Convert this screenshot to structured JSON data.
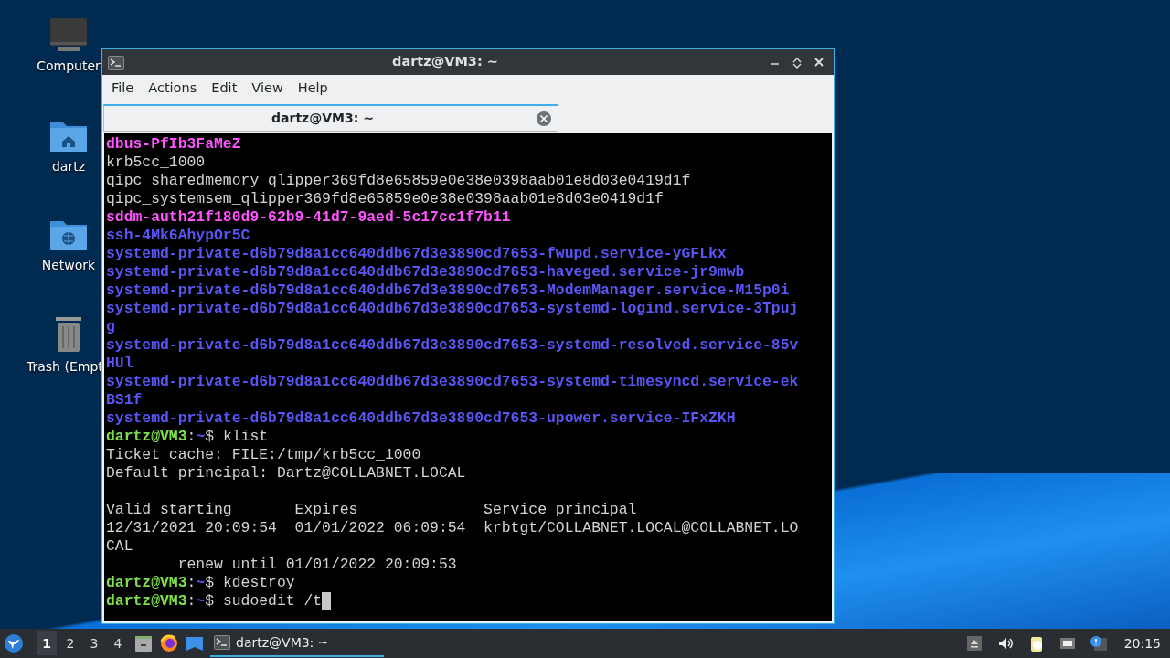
{
  "desktop_icons": [
    {
      "label": "Computer",
      "kind": "computer"
    },
    {
      "label": "dartz",
      "kind": "home"
    },
    {
      "label": "Network",
      "kind": "network"
    },
    {
      "label": "Trash (Empt",
      "kind": "trash"
    }
  ],
  "window": {
    "title": "dartz@VM3: ~",
    "menu": [
      "File",
      "Actions",
      "Edit",
      "View",
      "Help"
    ],
    "tabs": [
      {
        "label": "dartz@VM3: ~",
        "selected": true
      }
    ],
    "terminal_lines": [
      [
        {
          "kind": "socket",
          "text": "dbus-PfIb3FaMeZ"
        }
      ],
      [
        {
          "kind": "plain",
          "text": "krb5cc_1000"
        }
      ],
      [
        {
          "kind": "plain",
          "text": "qipc_sharedmemory_qlipper369fd8e65859e0e38e0398aab01e8d03e0419d1f"
        }
      ],
      [
        {
          "kind": "plain",
          "text": "qipc_systemsem_qlipper369fd8e65859e0e38e0398aab01e8d03e0419d1f"
        }
      ],
      [
        {
          "kind": "socket",
          "text": "sddm-auth21f180d9-62b9-41d7-9aed-5c17cc1f7b11"
        }
      ],
      [
        {
          "kind": "dir",
          "text": "ssh-4Mk6AhypOr5C"
        }
      ],
      [
        {
          "kind": "dir",
          "text": "systemd-private-d6b79d8a1cc640ddb67d3e3890cd7653-fwupd.service-yGFLkx"
        }
      ],
      [
        {
          "kind": "dir",
          "text": "systemd-private-d6b79d8a1cc640ddb67d3e3890cd7653-haveged.service-jr9mwb"
        }
      ],
      [
        {
          "kind": "dir",
          "text": "systemd-private-d6b79d8a1cc640ddb67d3e3890cd7653-ModemManager.service-M15p0i"
        }
      ],
      [
        {
          "kind": "dir",
          "text": "systemd-private-d6b79d8a1cc640ddb67d3e3890cd7653-systemd-logind.service-3Tpuj"
        }
      ],
      [
        {
          "kind": "dir",
          "text": "g"
        }
      ],
      [
        {
          "kind": "dir",
          "text": "systemd-private-d6b79d8a1cc640ddb67d3e3890cd7653-systemd-resolved.service-85v"
        }
      ],
      [
        {
          "kind": "dir",
          "text": "HUl"
        }
      ],
      [
        {
          "kind": "dir",
          "text": "systemd-private-d6b79d8a1cc640ddb67d3e3890cd7653-systemd-timesyncd.service-ek"
        }
      ],
      [
        {
          "kind": "dir",
          "text": "BS1f"
        }
      ],
      [
        {
          "kind": "dir",
          "text": "systemd-private-d6b79d8a1cc640ddb67d3e3890cd7653-upower.service-IFxZKH"
        }
      ],
      [
        {
          "kind": "user",
          "text": "dartz@VM3"
        },
        {
          "kind": "plain",
          "text": ":"
        },
        {
          "kind": "path",
          "text": "~"
        },
        {
          "kind": "plain",
          "text": "$ klist"
        }
      ],
      [
        {
          "kind": "plain",
          "text": "Ticket cache: FILE:/tmp/krb5cc_1000"
        }
      ],
      [
        {
          "kind": "plain",
          "text": "Default principal: Dartz@COLLABNET.LOCAL"
        }
      ],
      [
        {
          "kind": "blank"
        }
      ],
      [
        {
          "kind": "plain",
          "text": "Valid starting       Expires              Service principal"
        }
      ],
      [
        {
          "kind": "plain",
          "text": "12/31/2021 20:09:54  01/01/2022 06:09:54  krbtgt/COLLABNET.LOCAL@COLLABNET.LO"
        }
      ],
      [
        {
          "kind": "plain",
          "text": "CAL"
        }
      ],
      [
        {
          "kind": "plain",
          "text": "        renew until 01/01/2022 20:09:53"
        }
      ],
      [
        {
          "kind": "user",
          "text": "dartz@VM3"
        },
        {
          "kind": "plain",
          "text": ":"
        },
        {
          "kind": "path",
          "text": "~"
        },
        {
          "kind": "plain",
          "text": "$ kdestroy"
        }
      ],
      [
        {
          "kind": "user",
          "text": "dartz@VM3"
        },
        {
          "kind": "plain",
          "text": ":"
        },
        {
          "kind": "path",
          "text": "~"
        },
        {
          "kind": "plain",
          "text": "$ sudoedit /t"
        },
        {
          "kind": "cursor"
        }
      ]
    ]
  },
  "taskbar": {
    "workspaces": [
      {
        "label": "1",
        "selected": true
      },
      {
        "label": "2",
        "selected": false
      },
      {
        "label": "3",
        "selected": false
      },
      {
        "label": "4",
        "selected": false
      }
    ],
    "launchers": [
      {
        "kind": "file-cabinet"
      },
      {
        "kind": "browser"
      },
      {
        "kind": "window"
      }
    ],
    "tasks": [
      {
        "label": "dartz@VM3: ~",
        "selected": true
      }
    ],
    "clock": "20:15"
  }
}
